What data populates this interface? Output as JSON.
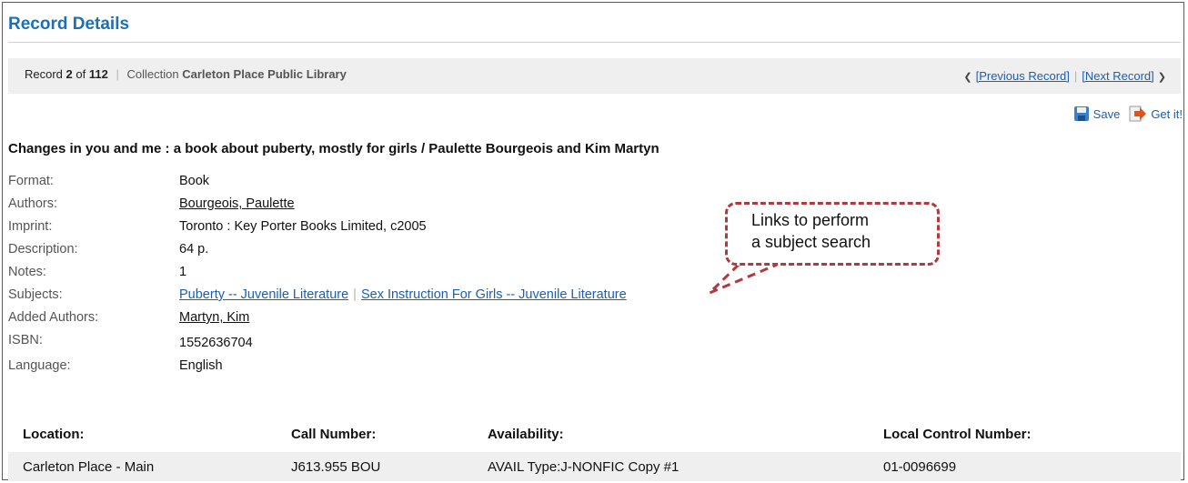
{
  "page": {
    "title": "Record Details"
  },
  "record_bar": {
    "record_label": "Record",
    "record_index": "2",
    "of_label": "of",
    "record_total": "112",
    "collection_label": "Collection",
    "collection_name": "Carleton Place Public Library",
    "prev_link": "[Previous Record]",
    "next_link": "[Next Record]"
  },
  "actions": {
    "save": "Save",
    "get_it": "Get it!"
  },
  "record": {
    "title": "Changes in you and me : a book about puberty, mostly for girls / Paulette Bourgeois and Kim Martyn",
    "fields": {
      "format": {
        "label": "Format:",
        "value": "Book"
      },
      "authors": {
        "label": "Authors:",
        "value": "Bourgeois, Paulette"
      },
      "imprint": {
        "label": "Imprint:",
        "value": "Toronto : Key Porter Books Limited, c2005"
      },
      "description": {
        "label": "Description:",
        "value": "64 p."
      },
      "notes": {
        "label": "Notes:",
        "value": "1"
      },
      "subjects": {
        "label": "Subjects:",
        "values": [
          "Puberty -- Juvenile Literature",
          "Sex Instruction For Girls -- Juvenile Literature"
        ]
      },
      "added_authors": {
        "label": "Added Authors:",
        "value": "Martyn, Kim"
      },
      "isbn": {
        "label": "ISBN:",
        "value": "1552636704"
      },
      "language": {
        "label": "Language:",
        "value": "English"
      }
    }
  },
  "callout": {
    "line1": "Links to perform",
    "line2": "a subject search"
  },
  "holdings": {
    "headers": {
      "location": "Location:",
      "call_number": "Call Number:",
      "availability": "Availability:",
      "control": "Local Control Number:"
    },
    "row": {
      "location": "Carleton Place - Main",
      "call_number": "J613.955 BOU",
      "availability": "AVAIL Type:J-NONFIC Copy #1",
      "control": "01-0096699"
    }
  },
  "colors": {
    "heading": "#1f6fb1",
    "link": "#1a5fb4",
    "callout_border": "#b03a3f",
    "bar_bg": "#efefef"
  }
}
